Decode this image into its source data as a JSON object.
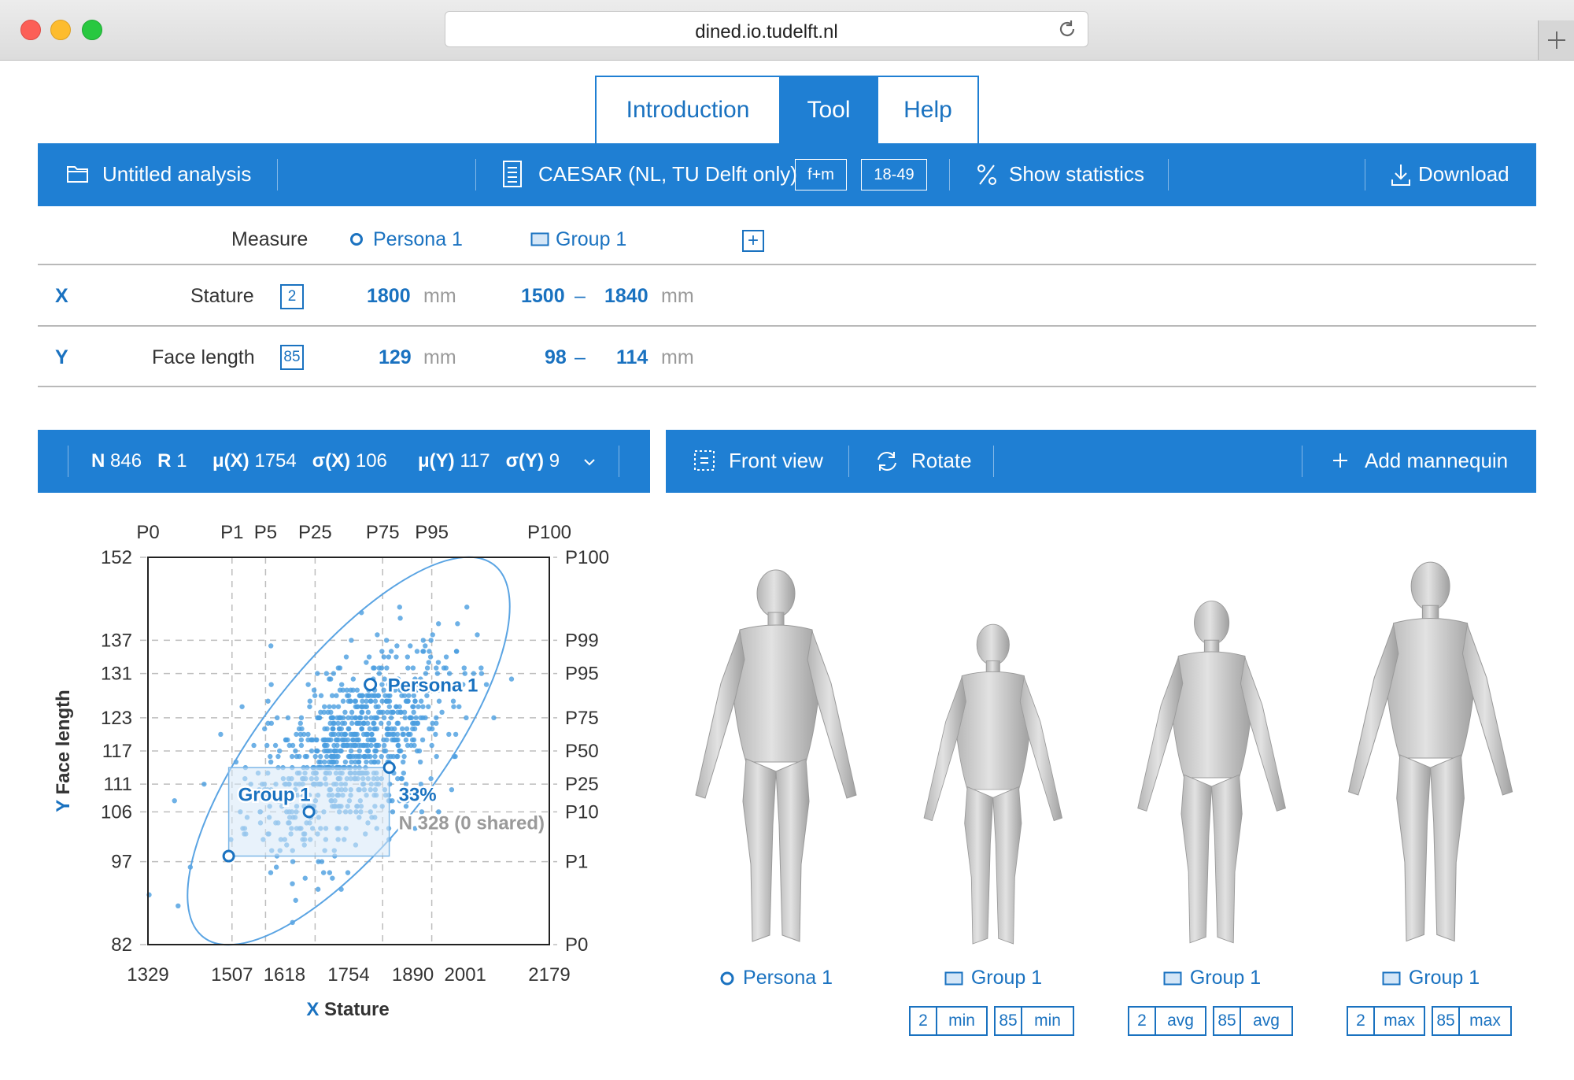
{
  "browser": {
    "url": "dined.io.tudelft.nl"
  },
  "tabs": [
    {
      "label": "Introduction",
      "active": false
    },
    {
      "label": "Tool",
      "active": true
    },
    {
      "label": "Help",
      "active": false
    }
  ],
  "toolbar": {
    "analysis_name": "Untitled analysis",
    "dataset": "CAESAR (NL, TU Delft only)",
    "sex_chip": "f+m",
    "age_chip": "18-49",
    "show_statistics": "Show statistics",
    "download": "Download"
  },
  "measures": {
    "header_measure": "Measure",
    "header_persona": "Persona 1",
    "header_group": "Group 1",
    "add_symbol": "+",
    "rows": [
      {
        "axis": "X",
        "name": "Stature",
        "code": "2",
        "persona_value": "1800",
        "unit": "mm",
        "group_min": "1500",
        "dash": "–",
        "group_max": "1840"
      },
      {
        "axis": "Y",
        "name": "Face length",
        "code": "85",
        "persona_value": "129",
        "unit": "mm",
        "group_min": "98",
        "dash": "–",
        "group_max": "114"
      }
    ]
  },
  "stats_bar": {
    "n_label": "N",
    "n_value": "846",
    "r_label": "R",
    "r_value": "1",
    "mux_label": "μ(X)",
    "mux_value": "1754",
    "sigx_label": "σ(X)",
    "sigx_value": "106",
    "muy_label": "μ(Y)",
    "muy_value": "117",
    "sigy_label": "σ(Y)",
    "sigy_value": "9"
  },
  "view_bar": {
    "front_view": "Front view",
    "rotate": "Rotate",
    "add_mannequin": "Add mannequin"
  },
  "chart_data": {
    "type": "scatter",
    "title": "",
    "xlabel": "Stature",
    "xlabel_axis": "X",
    "ylabel": "Face length",
    "ylabel_axis": "Y",
    "xlim": [
      1329,
      2179
    ],
    "ylim": [
      82,
      152
    ],
    "x_ticks": [
      1329,
      1507,
      1618,
      1754,
      1890,
      2001,
      2179
    ],
    "y_ticks": [
      152,
      137,
      131,
      123,
      117,
      111,
      106,
      97,
      82
    ],
    "top_percentiles": [
      {
        "label": "P0",
        "x": 1329
      },
      {
        "label": "P1",
        "x": 1507
      },
      {
        "label": "P5",
        "x": 1578
      },
      {
        "label": "P25",
        "x": 1683
      },
      {
        "label": "P75",
        "x": 1826
      },
      {
        "label": "P95",
        "x": 1930
      },
      {
        "label": "P100",
        "x": 2179
      }
    ],
    "right_percentiles": [
      {
        "label": "P100",
        "y": 152
      },
      {
        "label": "P99",
        "y": 137
      },
      {
        "label": "P95",
        "y": 131
      },
      {
        "label": "P75",
        "y": 123
      },
      {
        "label": "P50",
        "y": 117
      },
      {
        "label": "P25",
        "y": 111
      },
      {
        "label": "P10",
        "y": 106
      },
      {
        "label": "P1",
        "y": 97
      },
      {
        "label": "P0",
        "y": 82
      }
    ],
    "mean": {
      "x": 1754,
      "y": 117,
      "sx": 106,
      "sy": 9,
      "r": 1
    },
    "persona": {
      "name": "Persona 1",
      "x": 1800,
      "y": 129
    },
    "group": {
      "name": "Group 1",
      "xmin": 1500,
      "xmax": 1840,
      "ymin": 98,
      "ymax": 114,
      "center_x": 1670,
      "center_y": 106
    },
    "group_percent": "33%",
    "group_count": "N 328 (0 shared)",
    "n": 846
  },
  "mannequins": [
    {
      "label": "Persona 1",
      "kind": "persona",
      "chips": []
    },
    {
      "label": "Group 1",
      "kind": "group",
      "chips": [
        "2",
        "min",
        "85",
        "min"
      ]
    },
    {
      "label": "Group 1",
      "kind": "group",
      "chips": [
        "2",
        "avg",
        "85",
        "avg"
      ]
    },
    {
      "label": "Group 1",
      "kind": "group",
      "chips": [
        "2",
        "max",
        "85",
        "max"
      ]
    }
  ],
  "colors": {
    "accent": "#1f7fd3",
    "text_blue": "#1a72c0",
    "scatter": "#4a9ee0"
  }
}
